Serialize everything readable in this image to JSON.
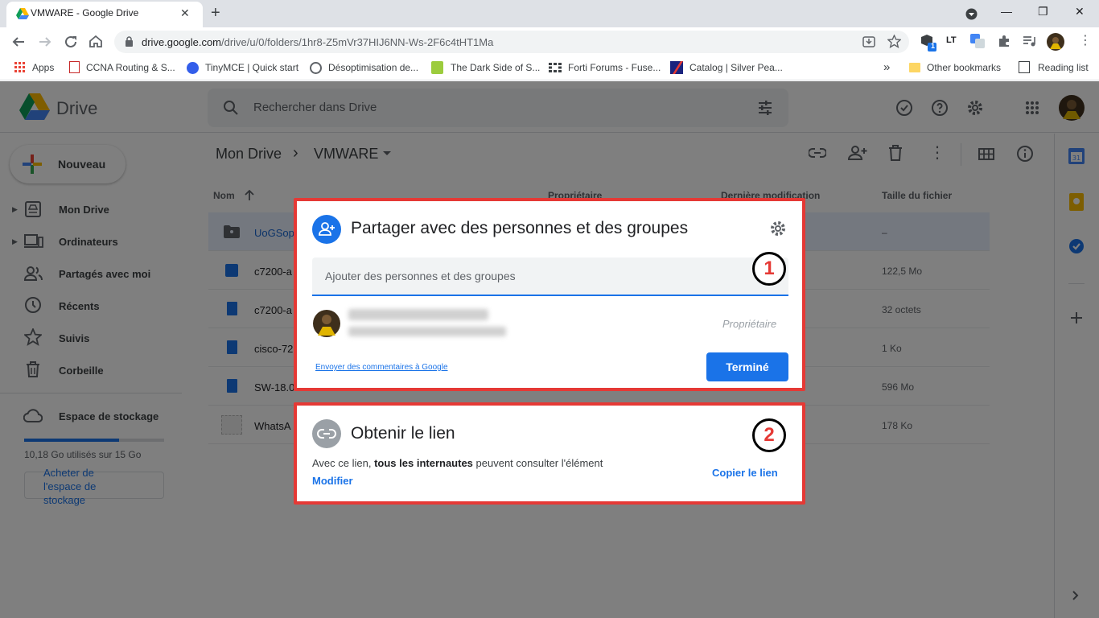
{
  "browser": {
    "tab_title": "VMWARE - Google Drive",
    "tab_close": "✕",
    "new_tab": "+",
    "url_host": "drive.google.com",
    "url_path": "/drive/u/0/folders/1hr8-Z5mVr37HIJ6NN-Ws-2F6c4tHT1Ma",
    "ext_badge": "1",
    "ext_lt": "LT",
    "win_min": "—",
    "win_max": "❐",
    "win_close": "✕",
    "bookmarks": [
      "Apps",
      "CCNA Routing & S...",
      "TinyMCE | Quick start",
      "Désoptimisation de...",
      "The Dark Side of S...",
      "Forti Forums - Fuse...",
      "Catalog | Silver Pea..."
    ],
    "bookmarks_more": "»",
    "other_bookmarks": "Other bookmarks",
    "reading_list": "Reading list"
  },
  "drive": {
    "title": "Drive",
    "search_placeholder": "Rechercher dans Drive",
    "new_button": "Nouveau",
    "nav": [
      "Mon Drive",
      "Ordinateurs",
      "Partagés avec moi",
      "Récents",
      "Suivis",
      "Corbeille"
    ],
    "storage_label": "Espace de stockage",
    "storage_used": "10,18 Go utilisés sur 15 Go",
    "storage_used_fraction": 0.68,
    "buy_storage": "Acheter de l'espace de stockage",
    "breadcrumb_root": "Mon Drive",
    "breadcrumb_sep": "›",
    "breadcrumb_current": "VMWARE",
    "columns": {
      "name": "Nom",
      "owner": "Propriétaire",
      "modified": "Dernière modification",
      "size": "Taille du fichier"
    },
    "files": [
      {
        "name": "UoGSop",
        "size": "–"
      },
      {
        "name": "c7200-a",
        "size": "122,5 Mo"
      },
      {
        "name": "c7200-a",
        "size": "32 octets"
      },
      {
        "name": "cisco-72",
        "size": "1 Ko"
      },
      {
        "name": "SW-18.0",
        "size": "596 Mo"
      },
      {
        "name": "WhatsA",
        "size": "178 Ko"
      }
    ]
  },
  "share_dialog": {
    "title": "Partager avec des personnes et des groupes",
    "add_placeholder": "Ajouter des personnes et des groupes",
    "owner_role": "Propriétaire",
    "feedback_link": "Envoyer des commentaires à Google",
    "done_button": "Terminé",
    "badge": "1"
  },
  "link_dialog": {
    "title": "Obtenir le lien",
    "desc_prefix": "Avec ce lien, ",
    "desc_bold": "tous les internautes",
    "desc_suffix": " peuvent consulter l'élément",
    "modify": "Modifier",
    "copy_link": "Copier le lien",
    "badge": "2"
  },
  "colors": {
    "accent": "#1a73e8",
    "highlight_border": "#e53935"
  }
}
